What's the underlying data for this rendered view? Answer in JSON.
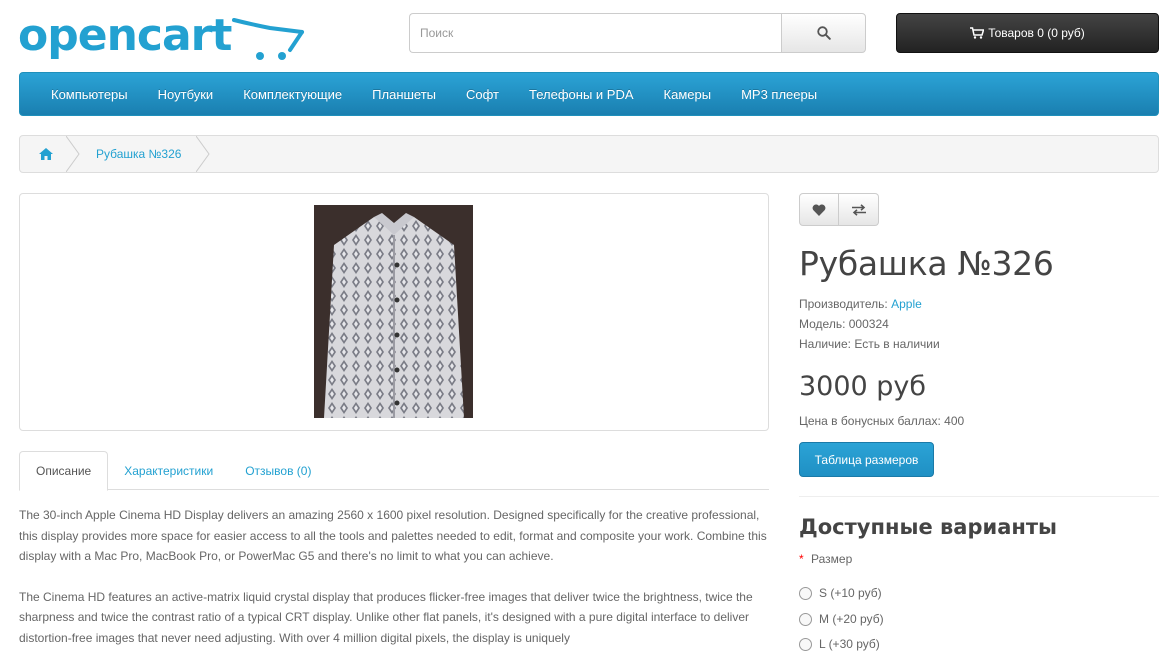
{
  "header": {
    "logo_text": "opencart",
    "search_placeholder": "Поиск",
    "cart_label": "Товаров 0 (0 руб)"
  },
  "menu": {
    "items": [
      "Компьютеры",
      "Ноутбуки",
      "Комплектующие",
      "Планшеты",
      "Софт",
      "Телефоны и PDA",
      "Камеры",
      "MP3 плееры"
    ]
  },
  "breadcrumb": {
    "items": [
      "Рубашка №326"
    ]
  },
  "tabs": [
    "Описание",
    "Характеристики",
    "Отзывов (0)"
  ],
  "description": {
    "paragraphs": [
      "The 30-inch Apple Cinema HD Display delivers an amazing 2560 x 1600 pixel resolution. Designed specifically for the creative professional, this display provides more space for easier access to all the tools and palettes needed to edit, format and composite your work. Combine this display with a Mac Pro, MacBook Pro, or PowerMac G5 and there's no limit to what you can achieve.",
      "The Cinema HD features an active-matrix liquid crystal display that produces flicker-free images that deliver twice the brightness, twice the sharpness and twice the contrast ratio of a typical CRT display. Unlike other flat panels, it's designed with a pure digital interface to deliver distortion-free images that never need adjusting. With over 4 million digital pixels, the display is uniquely"
    ]
  },
  "product": {
    "title": "Рубашка №326",
    "manufacturer_label": "Производитель:",
    "manufacturer": "Apple",
    "model_label": "Модель:",
    "model": "000324",
    "availability_label": "Наличие:",
    "availability": "Есть в наличии",
    "price": "3000 руб",
    "bonus_label": "Цена в бонусных баллах:",
    "bonus": "400",
    "size_table_button": "Таблица размеров"
  },
  "options": {
    "title": "Доступные варианты",
    "required_mark": "*",
    "size_label": "Размер",
    "values": [
      "S (+10 руб)",
      "M (+20 руб)",
      "L (+30 руб)"
    ]
  },
  "colors": {
    "brand": "#23a1d1",
    "dark_button": "#2b2b2b"
  },
  "icons": [
    "search-icon",
    "shopping-cart-icon",
    "home-icon",
    "heart-icon",
    "compare-icon"
  ]
}
